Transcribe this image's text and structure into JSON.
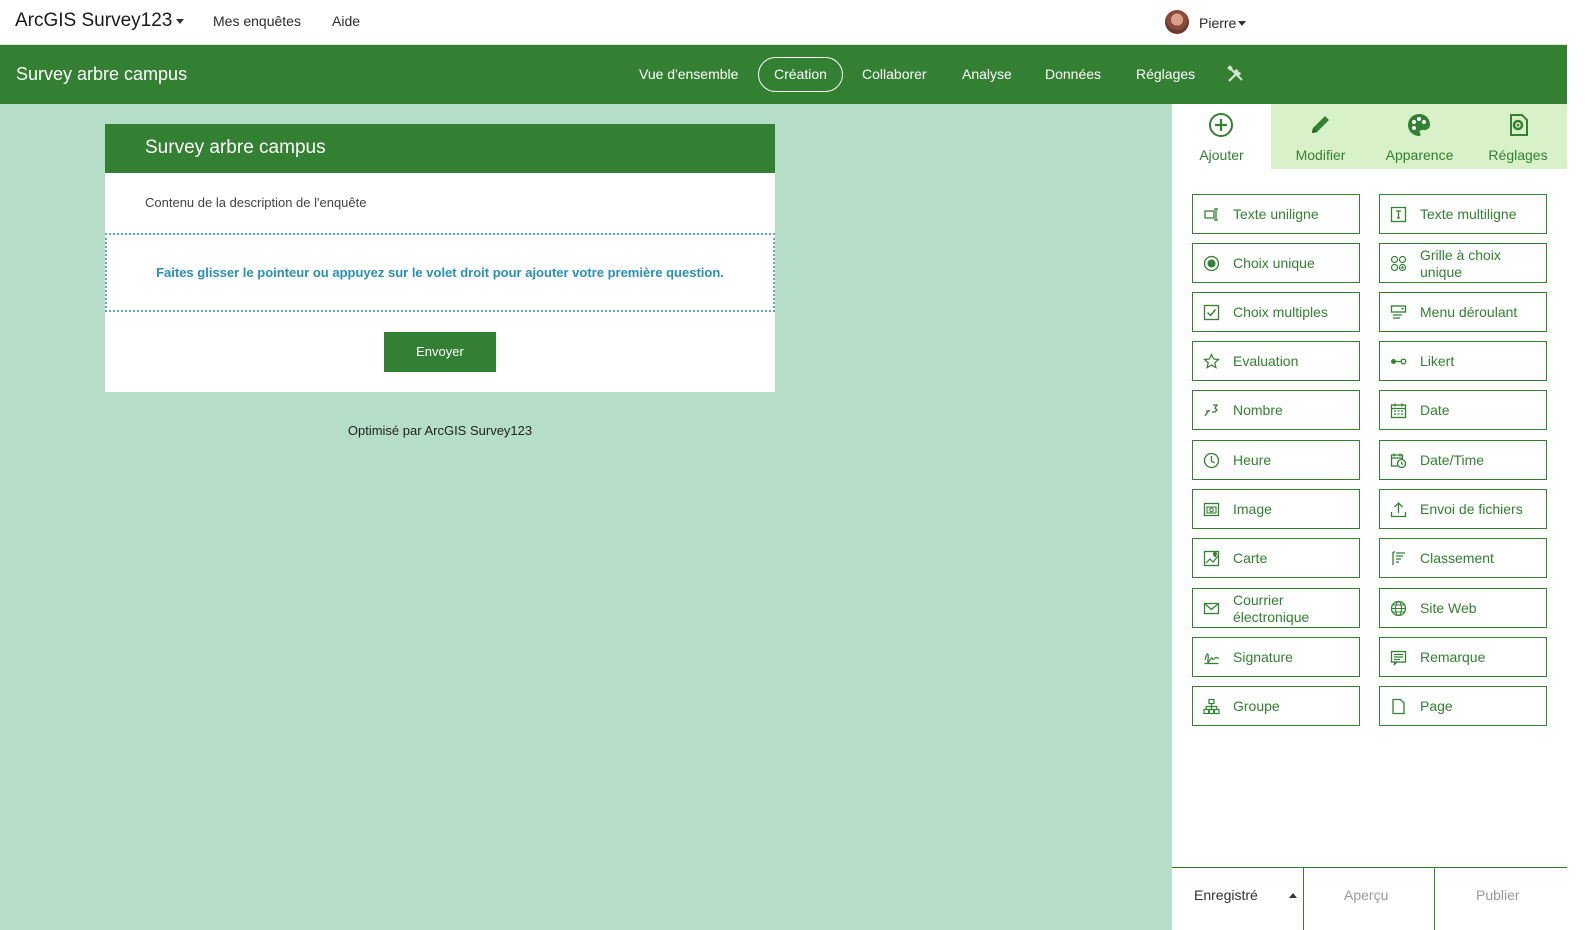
{
  "topbar": {
    "app_title": "ArcGIS Survey123",
    "links": [
      "Mes enquêtes",
      "Aide"
    ],
    "user_name": "Pierre"
  },
  "header": {
    "survey_title": "Survey arbre campus",
    "tabs": [
      "Vue d'ensemble",
      "Création",
      "Collaborer",
      "Analyse",
      "Données",
      "Réglages"
    ],
    "active_tab": "Création"
  },
  "form": {
    "title": "Survey arbre campus",
    "description": "Contenu de la description de l'enquête",
    "drop_hint": "Faites glisser le pointeur ou appuyez sur le volet droit pour ajouter votre première question.",
    "submit_label": "Envoyer",
    "powered_by": "Optimisé par ArcGIS Survey123"
  },
  "panel": {
    "tabs": [
      {
        "label": "Ajouter",
        "icon": "add-circle-icon"
      },
      {
        "label": "Modifier",
        "icon": "pencil-icon"
      },
      {
        "label": "Apparence",
        "icon": "palette-icon"
      },
      {
        "label": "Réglages",
        "icon": "settings-icon"
      }
    ],
    "questions": [
      {
        "label": "Texte uniligne",
        "icon": "single-line-text-icon"
      },
      {
        "label": "Texte multiligne",
        "icon": "multi-line-text-icon"
      },
      {
        "label": "Choix unique",
        "icon": "radio-icon"
      },
      {
        "label": "Grille à choix unique",
        "icon": "grid-choice-icon"
      },
      {
        "label": "Choix multiples",
        "icon": "checkbox-icon"
      },
      {
        "label": "Menu déroulant",
        "icon": "dropdown-icon"
      },
      {
        "label": "Evaluation",
        "icon": "star-icon"
      },
      {
        "label": "Likert",
        "icon": "likert-icon"
      },
      {
        "label": "Nombre",
        "icon": "number-icon"
      },
      {
        "label": "Date",
        "icon": "calendar-icon"
      },
      {
        "label": "Heure",
        "icon": "clock-icon"
      },
      {
        "label": "Date/Time",
        "icon": "datetime-icon"
      },
      {
        "label": "Image",
        "icon": "image-icon"
      },
      {
        "label": "Envoi de fichiers",
        "icon": "upload-icon"
      },
      {
        "label": "Carte",
        "icon": "map-icon"
      },
      {
        "label": "Classement",
        "icon": "ranking-icon"
      },
      {
        "label": "Courrier électronique",
        "icon": "email-icon"
      },
      {
        "label": "Site Web",
        "icon": "globe-icon"
      },
      {
        "label": "Signature",
        "icon": "signature-icon"
      },
      {
        "label": "Remarque",
        "icon": "note-icon"
      },
      {
        "label": "Groupe",
        "icon": "group-icon"
      },
      {
        "label": "Page",
        "icon": "page-icon"
      }
    ]
  },
  "footer": {
    "saved": "Enregistré",
    "preview": "Aperçu",
    "publish": "Publier"
  },
  "colors": {
    "brand_green": "#338033",
    "canvas_bg": "#b5ddc8",
    "tab_inactive_bg": "#d9f1c8",
    "hint_blue": "#2a8fb5"
  }
}
